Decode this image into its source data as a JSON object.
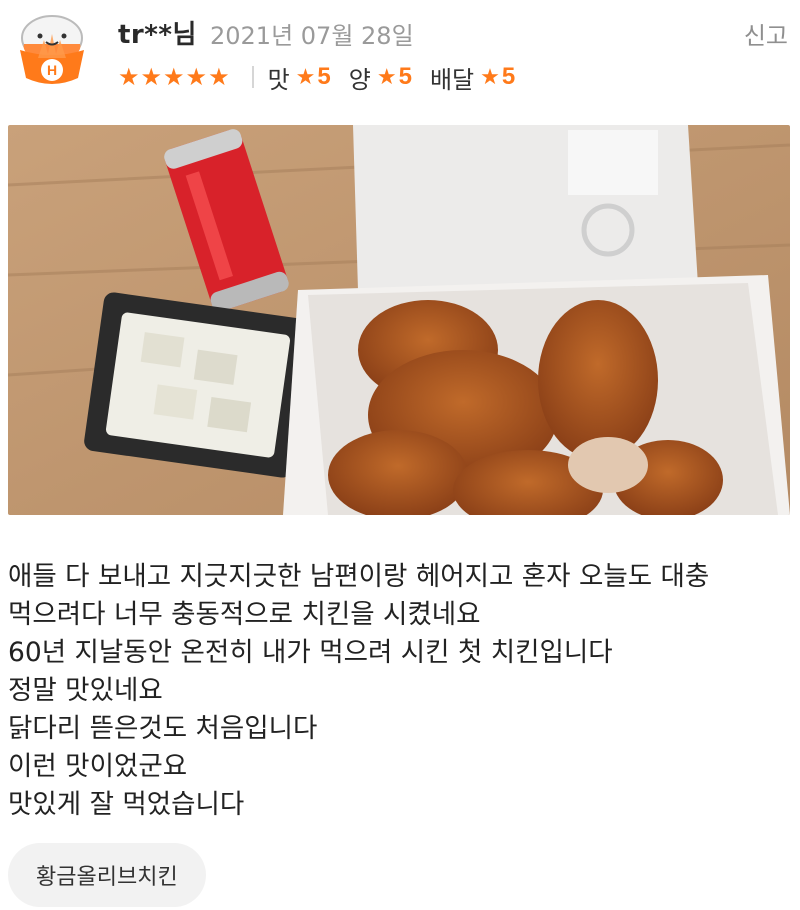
{
  "review": {
    "user": "tr**님",
    "date": "2021년 07월 28일",
    "report_label": "신고",
    "overall_stars": 5,
    "ratings": [
      {
        "label": "맛",
        "value": "5"
      },
      {
        "label": "양",
        "value": "5"
      },
      {
        "label": "배달",
        "value": "5"
      }
    ],
    "body_lines": [
      "애들 다 보내고 지긋지긋한 남편이랑 헤어지고 혼자 오늘도 대충",
      "먹으려다 너무 충동적으로 치킨을 시켰네요",
      "60년 지날동안 온전히 내가 먹으려 시킨 첫 치킨입니다",
      "정말 맛있네요",
      "닭다리 뜯은것도 처음입니다",
      "이런 맛이었군요",
      "맛있게 잘 먹었습니다"
    ],
    "menu_tag": "황금올리브치킨"
  },
  "colors": {
    "accent": "#ff7a1a",
    "muted": "#9a9a9a",
    "tag_bg": "#f2f2f2"
  },
  "icons": {
    "avatar": "rice-ball-mascot-icon",
    "rating": "star-icon"
  }
}
